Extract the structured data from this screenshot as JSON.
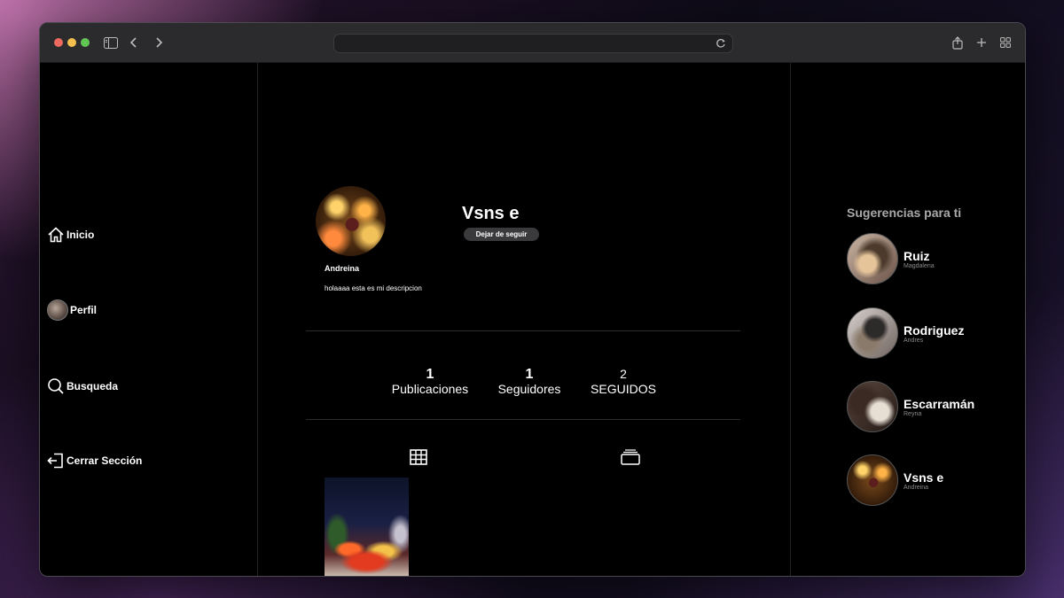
{
  "browser": {
    "url": ""
  },
  "sidebar": {
    "items": [
      {
        "label": "Inicio",
        "icon": "home-icon"
      },
      {
        "label": "Perfil",
        "icon": "avatar"
      },
      {
        "label": "Busqueda",
        "icon": "search-icon"
      },
      {
        "label": "Cerrar Sección",
        "icon": "logout-icon"
      }
    ]
  },
  "profile": {
    "username": "Vsns e",
    "follow_button": "Dejar de seguir",
    "display_name": "Andreina",
    "bio": "holaaaa esta es mi descripcion",
    "stats": [
      {
        "value": "1",
        "label": "Publicaciones"
      },
      {
        "value": "1",
        "label": "Seguidores"
      },
      {
        "value": "2",
        "label": "SEGUIDOS"
      }
    ],
    "tabs": [
      {
        "icon": "grid-icon"
      },
      {
        "icon": "carousel-icon"
      }
    ]
  },
  "suggestions": {
    "title": "Sugerencias para ti",
    "items": [
      {
        "name": "Ruiz",
        "sub": "Magdalena"
      },
      {
        "name": "Rodriguez",
        "sub": "Andres"
      },
      {
        "name": "Escarramán",
        "sub": "Reyna"
      },
      {
        "name": "Vsns e",
        "sub": "Andreina"
      }
    ]
  }
}
